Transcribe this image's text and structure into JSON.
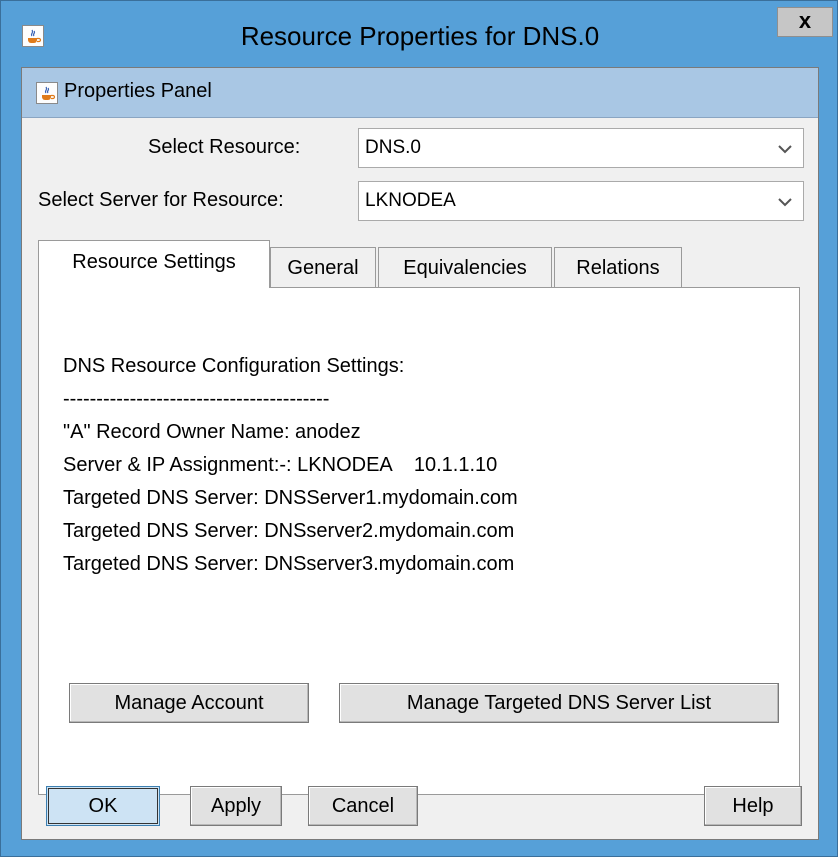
{
  "window": {
    "title": "Resource Properties for DNS.0",
    "close_label": "x"
  },
  "panel": {
    "title": "Properties Panel"
  },
  "select_resource": {
    "label": "Select Resource:",
    "value": "DNS.0"
  },
  "select_server": {
    "label": "Select Server for Resource:",
    "value": "LKNODEA"
  },
  "tabs": [
    {
      "label": "Resource Settings",
      "active": true
    },
    {
      "label": "General",
      "active": false
    },
    {
      "label": "Equivalencies",
      "active": false
    },
    {
      "label": "Relations",
      "active": false
    }
  ],
  "settings": {
    "lines": [
      "DNS Resource Configuration Settings:",
      "----------------------------------------",
      "\"A\" Record Owner Name: anodez",
      "Server & IP Assignment:-: LKNODEA    10.1.1.10",
      "Targeted DNS Server: DNSServer1.mydomain.com",
      "Targeted DNS Server: DNSserver2.mydomain.com",
      "Targeted DNS Server: DNSserver3.mydomain.com"
    ]
  },
  "actions": {
    "manage_account": "Manage Account",
    "manage_dns_list": "Manage Targeted DNS Server List"
  },
  "footer": {
    "ok": "OK",
    "apply": "Apply",
    "cancel": "Cancel",
    "help": "Help"
  },
  "icons": {
    "app": "java-coffee-cup-icon",
    "dropdown": "chevron-down-icon",
    "close": "close-icon"
  },
  "colors": {
    "titlebar": "#56a0d8",
    "panel_header": "#a9c7e4",
    "default_button": "#cde3f4"
  }
}
